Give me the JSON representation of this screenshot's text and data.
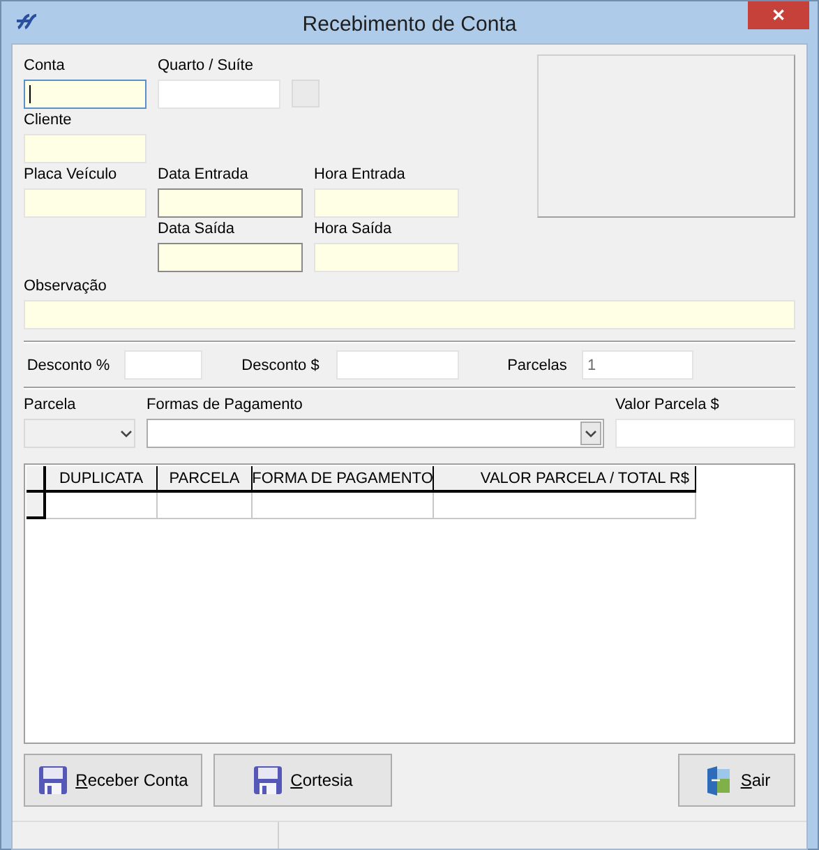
{
  "window": {
    "title": "Recebimento de Conta",
    "close": "✕"
  },
  "fields": {
    "conta": {
      "label": "Conta",
      "kind": "required",
      "focused": true
    },
    "quarto": {
      "label": "Quarto / Suíte",
      "kind": "plain",
      "focused": false
    },
    "cliente": {
      "label": "Cliente",
      "kind": "required",
      "focused": false
    },
    "placa": {
      "label": "Placa Veículo",
      "kind": "required",
      "focused": false
    },
    "data_entrada": {
      "label": "Data Entrada",
      "kind": "date",
      "focused": false
    },
    "hora_entrada": {
      "label": "Hora Entrada",
      "kind": "required",
      "focused": false
    },
    "data_saida": {
      "label": "Data Saída",
      "kind": "date",
      "focused": false
    },
    "hora_saida": {
      "label": "Hora Saída",
      "kind": "required",
      "focused": false
    },
    "observacao": {
      "label": "Observação",
      "kind": "required",
      "focused": false
    }
  },
  "discount": [
    {
      "label": "Desconto %"
    },
    {
      "label": "Desconto $"
    },
    {
      "label": "Parcelas",
      "value": "1"
    }
  ],
  "payment": {
    "parcela": {
      "label": "Parcela",
      "disabled": true
    },
    "formas": {
      "label": "Formas de Pagamento",
      "disabled": false
    },
    "valor": {
      "label": "Valor Parcela $"
    }
  },
  "table": {
    "columns": [
      "DUPLICATA",
      "PARCELA",
      "FORMA DE PAGAMENTO",
      "VALOR PARCELA / TOTAL R$"
    ]
  },
  "buttons": [
    {
      "label": "Receber Conta"
    },
    {
      "label": "Cortesia"
    },
    {
      "label": "Sair"
    }
  ]
}
